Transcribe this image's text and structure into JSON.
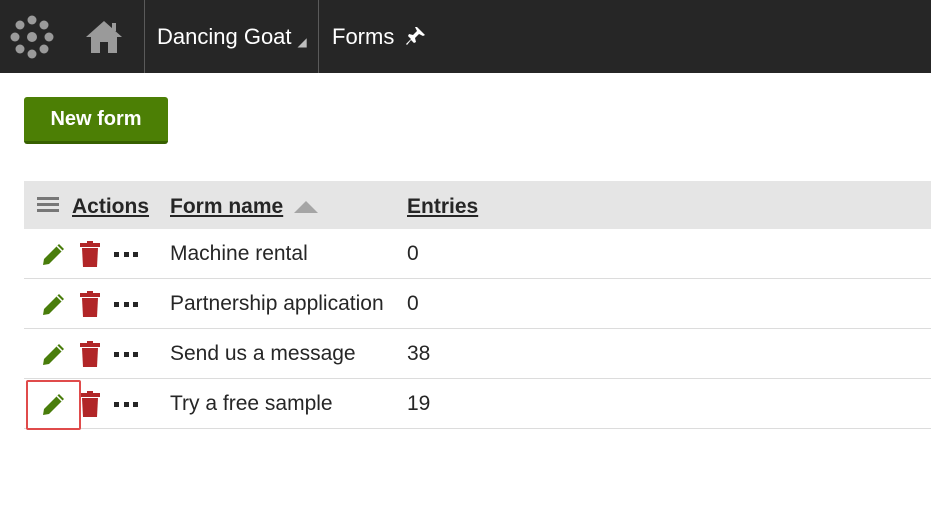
{
  "header": {
    "logo_icon": "kentico-logo-icon",
    "home_icon": "home-icon",
    "site_name": "Dancing Goat",
    "site_caret_icon": "caret-down-icon",
    "app_title": "Forms",
    "pin_icon": "pin-icon"
  },
  "toolbar": {
    "new_form_label": "New form"
  },
  "grid": {
    "columns": [
      {
        "label": "Actions"
      },
      {
        "label": "Form name",
        "sort": "ascending"
      },
      {
        "label": "Entries"
      }
    ],
    "rows": [
      {
        "name": "Machine rental",
        "entries": "0"
      },
      {
        "name": "Partnership application",
        "entries": "0"
      },
      {
        "name": "Send us a message",
        "entries": "38"
      },
      {
        "name": "Try a free sample",
        "entries": "19"
      }
    ]
  },
  "colors": {
    "header_bg": "#262626",
    "primary_button": "#4c7f05",
    "edit_icon": "#497d0b",
    "delete_icon": "#b12628",
    "highlight": "#e04b4b"
  }
}
